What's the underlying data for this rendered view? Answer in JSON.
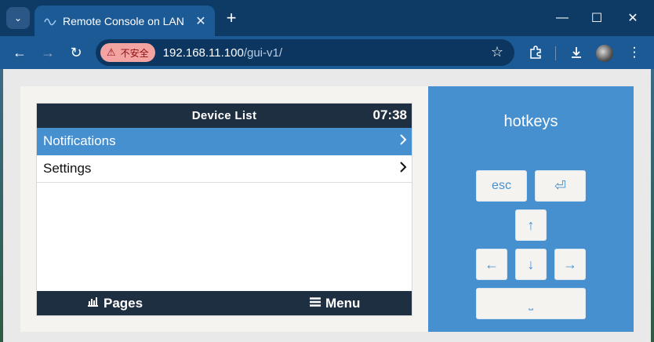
{
  "browser": {
    "tab": {
      "title": "Remote Console on LAN",
      "favicon": "wave-icon"
    },
    "omnibox": {
      "security_label": "不安全",
      "url_host": "192.168.11.100",
      "url_path": "/gui-v1/"
    }
  },
  "console": {
    "header": {
      "title": "Device List",
      "time": "07:38"
    },
    "rows": [
      {
        "label": "Notifications",
        "selected": true
      },
      {
        "label": "Settings",
        "selected": false
      }
    ],
    "footer": {
      "pages_label": "Pages",
      "menu_label": "Menu"
    }
  },
  "hotkeys": {
    "title": "hotkeys",
    "keys": {
      "esc": "esc",
      "enter": "⏎",
      "up": "↑",
      "left": "←",
      "down": "↓",
      "right": "→",
      "space": "⎵"
    }
  },
  "colors": {
    "accent": "#4790d0",
    "console_bar": "#1f2f42",
    "browser_frame": "#0e3a66",
    "toolbar": "#1c5a96"
  }
}
